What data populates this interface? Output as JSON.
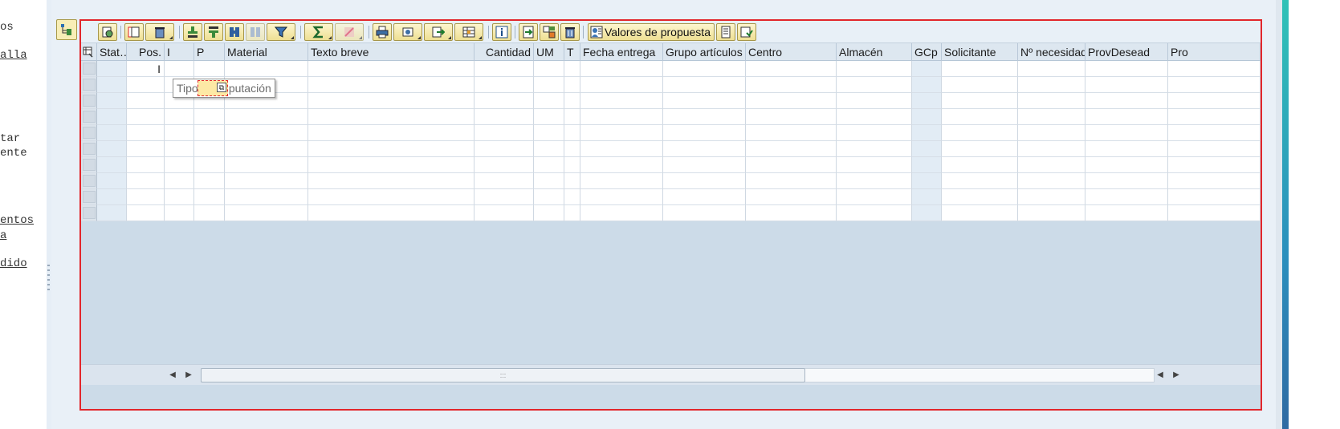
{
  "left_menu": {
    "items": [
      {
        "text": "os",
        "underline": false
      },
      {
        "text": "alla",
        "underline": true
      },
      {
        "text": "tar",
        "underline": false
      },
      {
        "text": "ente",
        "underline": false
      },
      {
        "text": "entos",
        "underline": true
      },
      {
        "text": " a",
        "underline": true
      },
      {
        "text": "dido",
        "underline": true
      }
    ]
  },
  "toolbar": {
    "proposal_label": "Valores de propuesta"
  },
  "table": {
    "columns": [
      {
        "key": "status",
        "label": "Stat…"
      },
      {
        "key": "pos",
        "label": "Pos."
      },
      {
        "key": "imp",
        "label": "I"
      },
      {
        "key": "p",
        "label": "P"
      },
      {
        "key": "material",
        "label": "Material"
      },
      {
        "key": "texto",
        "label": "Texto breve"
      },
      {
        "key": "cantidad",
        "label": "Cantidad"
      },
      {
        "key": "um",
        "label": "UM"
      },
      {
        "key": "t",
        "label": "T"
      },
      {
        "key": "fecha",
        "label": "Fecha entrega"
      },
      {
        "key": "grupo",
        "label": "Grupo artículos"
      },
      {
        "key": "centro",
        "label": "Centro"
      },
      {
        "key": "almacen",
        "label": "Almacén"
      },
      {
        "key": "gcp",
        "label": "GCp"
      },
      {
        "key": "solicitante",
        "label": "Solicitante"
      },
      {
        "key": "necesidad",
        "label": "Nº necesidad"
      },
      {
        "key": "provdesead",
        "label": "ProvDesead"
      },
      {
        "key": "pro",
        "label": "Pro"
      }
    ],
    "first_row_imp": "I",
    "tooltip": "Tipo de imputación"
  },
  "colors": {
    "frame_red": "#e2262b",
    "grid_blue": "#ccdbe8",
    "button_yellow": "#f8eeb6"
  },
  "icons": [
    "select-layout-icon",
    "details-icon",
    "select-all-icon",
    "delete-icon",
    "sort-asc-icon",
    "sort-desc-icon",
    "find-icon",
    "find-next-icon",
    "filter-icon",
    "sum-icon",
    "subtotal-icon",
    "print-icon",
    "views-icon",
    "export-icon",
    "layout-icon",
    "info-icon",
    "add-row-icon",
    "copy-row-icon",
    "delete-row-icon",
    "proposal-values-icon",
    "document-icon",
    "check-icon",
    "scroll-left-icon",
    "scroll-right-icon"
  ]
}
